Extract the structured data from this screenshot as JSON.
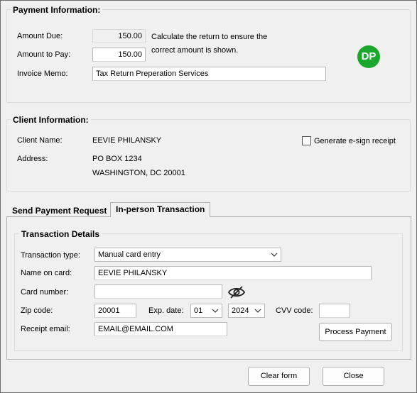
{
  "payment": {
    "title": "Payment Information:",
    "amount_due_label": "Amount Due:",
    "amount_due_value": "150.00",
    "amount_to_pay_label": "Amount to Pay:",
    "amount_to_pay_value": "150.00",
    "note_line1": "Calculate the return to ensure the",
    "note_line2": "correct amount is shown.",
    "invoice_memo_label": "Invoice Memo:",
    "invoice_memo_value": "Tax Return Preperation Services",
    "badge_initials": "DP",
    "badge_color": "#1aa72b"
  },
  "client": {
    "title": "Client Information:",
    "name_label": "Client Name:",
    "name_value": "EEVIE PHILANSKY",
    "address_label": "Address:",
    "address_line1": "PO BOX 1234",
    "address_line2": "WASHINGTON, DC 20001",
    "esign_label": "Generate e-sign receipt"
  },
  "tabs": [
    {
      "label": "Send Payment Request"
    },
    {
      "label": "In-person Transaction"
    }
  ],
  "transaction": {
    "title": "Transaction Details",
    "type_label": "Transaction type:",
    "type_value": "Manual card entry",
    "name_on_card_label": "Name on card:",
    "name_on_card_value": "EEVIE PHILANSKY",
    "card_number_label": "Card number:",
    "card_number_value": "",
    "zip_label": "Zip code:",
    "zip_value": "20001",
    "exp_label": "Exp. date:",
    "exp_month": "01",
    "exp_year": "2024",
    "cvv_label": "CVV code:",
    "cvv_value": "",
    "receipt_email_label": "Receipt email:",
    "receipt_email_value": "EMAIL@EMAIL.COM",
    "process_button": "Process Payment"
  },
  "footer": {
    "clear_button": "Clear form",
    "close_button": "Close"
  },
  "icons": {
    "card_visibility": "eye-slash-icon",
    "dropdown": "chevron-down-icon"
  }
}
